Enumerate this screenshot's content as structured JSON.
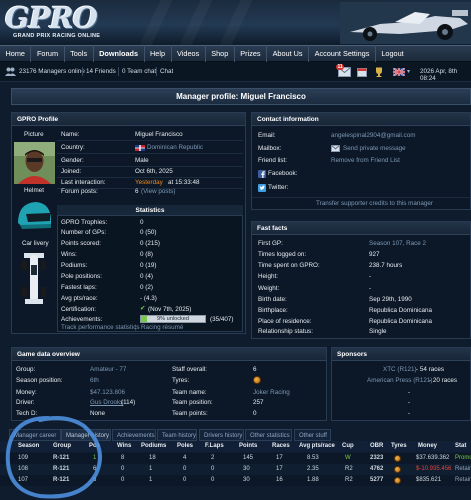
{
  "logo": {
    "mark": "GPRO",
    "tagline": "GRAND PRIX RACING ONLINE"
  },
  "nav": [
    "Home",
    "Forum",
    "Tools",
    "Downloads",
    "Help",
    "Videos",
    "Shop",
    "Prizes",
    "About Us",
    "Account Settings",
    "Logout"
  ],
  "status": {
    "managers_online": "23176 Managers online",
    "friends": "14 Friends",
    "team_chat": "0 Team chat",
    "chat": "Chat",
    "mail_badge": "11",
    "datetime": "2026 Apr, 8th 08:24"
  },
  "title": "Manager profile: Miguel Francisco",
  "profile": {
    "head": "GPRO Profile",
    "picture_label": "Picture",
    "helmet_label": "Helmet",
    "livery_label": "Car livery",
    "fields": [
      {
        "label": "Name:",
        "value": "Miguel Francisco"
      },
      {
        "label": "Country:",
        "value": "Dominican Republic"
      },
      {
        "label": "Gender:",
        "value": "Male"
      },
      {
        "label": "Joined:",
        "value": "Oct 6th, 2025"
      },
      {
        "label": "Last interaction:",
        "value": "Yesterday",
        "value_extra": "at 15:33:48"
      },
      {
        "label": "Forum posts:",
        "value": "6",
        "value_extra": "(View posts)"
      }
    ]
  },
  "statistics": {
    "head": "Statistics",
    "rows": [
      {
        "label": "GPRO Trophies:",
        "value": "0"
      },
      {
        "label": "Number of GPs:",
        "value": "0 (50)"
      },
      {
        "label": "Points scored:",
        "value": "0 (215)"
      },
      {
        "label": "Wins:",
        "value": "0 (8)"
      },
      {
        "label": "Podiums:",
        "value": "0 (19)"
      },
      {
        "label": "Pole positions:",
        "value": "0 (4)"
      },
      {
        "label": "Fastest laps:",
        "value": "0 (2)"
      },
      {
        "label": "Avg pts/race:",
        "value": "- (4.3)"
      },
      {
        "label": "Certification:",
        "value": "(Nov 7th, 2025)"
      },
      {
        "label": "Achievements:",
        "value": "9% unlocked",
        "value_extra": "(35/407)"
      }
    ],
    "achievements_fraction": 0.09,
    "links": [
      "Track performance statistics",
      "Racing résumé"
    ]
  },
  "contact": {
    "head": "Contact information",
    "rows": [
      {
        "label": "Email:",
        "value": "angelespinal2904@gmail.com"
      },
      {
        "label": "Mailbox:",
        "value": "Send private message"
      },
      {
        "label": "Friend list:",
        "value": "Remove from Friend List"
      },
      {
        "label": "Facebook:",
        "value": ""
      },
      {
        "label": "Twitter:",
        "value": ""
      }
    ],
    "footer": "Transfer supporter credits to this manager"
  },
  "fast_facts": {
    "head": "Fast facts",
    "rows": [
      {
        "label": "First GP:",
        "value": "Season 107, Race 2"
      },
      {
        "label": "Times logged on:",
        "value": "927"
      },
      {
        "label": "Time spent on GPRO:",
        "value": "238.7 hours"
      },
      {
        "label": "Height:",
        "value": "-"
      },
      {
        "label": "Weight:",
        "value": "-"
      },
      {
        "label": "Birth date:",
        "value": "Sep 29th, 1990"
      },
      {
        "label": "Birthplace:",
        "value": "Republica Dominicana"
      },
      {
        "label": "Place of residence:",
        "value": "Republica Dominicana"
      },
      {
        "label": "Relationship status:",
        "value": "Single"
      }
    ]
  },
  "game_data": {
    "head": "Game data overview",
    "left": [
      {
        "label": "Group:",
        "value": "Amateur - 77"
      },
      {
        "label": "Season position:",
        "value": "6th"
      },
      {
        "label": "Money:",
        "value": "$47.123.806"
      },
      {
        "label": "Driver:",
        "value": "Gus Drooks",
        "value_extra": "(114)"
      },
      {
        "label": "Tech D:",
        "value": "None"
      }
    ],
    "right": [
      {
        "label": "Staff overall:",
        "value": "6"
      },
      {
        "label": "Tyres:",
        "value": ""
      },
      {
        "label": "Team name:",
        "value": "Joker Racing"
      },
      {
        "label": "Team position:",
        "value": "257"
      },
      {
        "label": "Team points:",
        "value": "0"
      }
    ]
  },
  "sponsors": {
    "head": "Sponsors",
    "rows": [
      {
        "name": "XTC (R121)",
        "races": "- 54 races"
      },
      {
        "name": "American Press (R121)",
        "races": "- 20 races"
      },
      {
        "name": "-",
        "races": ""
      },
      {
        "name": "-",
        "races": ""
      },
      {
        "name": "-",
        "races": ""
      }
    ]
  },
  "tabs": [
    "Manager career",
    "Manager history",
    "Achievements",
    "Team history",
    "Drivers history",
    "Other statistics",
    "Other stuff"
  ],
  "career_table": {
    "columns": [
      "Season",
      "Group",
      "Pos",
      "Wins",
      "Podiums",
      "Poles",
      "F.Laps",
      "Points",
      "Races",
      "Avg pts/race",
      "Cup",
      "OBR",
      "Tyres",
      "Money",
      "Stat"
    ],
    "rows": [
      [
        "109",
        "R-121",
        "1",
        "8",
        "18",
        "4",
        "2",
        "145",
        "17",
        "8.53",
        "W",
        "2323",
        "",
        "$37.639.362",
        "Promo"
      ],
      [
        "108",
        "R-121",
        "6",
        "0",
        "1",
        "0",
        "0",
        "30",
        "17",
        "2.35",
        "R2",
        "4762",
        "",
        "$-10.935.456",
        "Retain"
      ],
      [
        "107",
        "R-121",
        "6",
        "0",
        "1",
        "0",
        "0",
        "30",
        "16",
        "1.88",
        "R2",
        "5277",
        "",
        "$835.621",
        "Retain"
      ]
    ]
  },
  "colors": {
    "accent_orange": "#f08a1c",
    "promo_green": "#79c94c",
    "negative_red": "#e1473a",
    "circle_annotation": "#4d8fde"
  }
}
